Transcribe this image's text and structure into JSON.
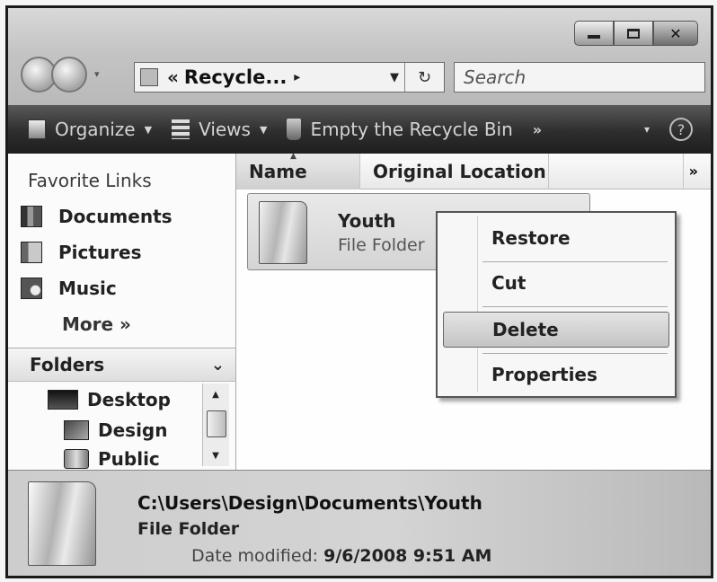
{
  "window": {
    "address": {
      "prefix": "«",
      "location": "Recycle...",
      "arrow": "▸"
    },
    "search_placeholder": "Search",
    "controls": {
      "minimize_icon": "minimize-icon",
      "maximize_icon": "maximize-icon",
      "close_glyph": "✕"
    }
  },
  "toolbar": {
    "organize": "Organize",
    "views": "Views",
    "empty_recycle_bin": "Empty the Recycle Bin",
    "more": "»",
    "help": "?"
  },
  "navpane": {
    "favorites_heading": "Favorite Links",
    "favorites": [
      {
        "label": "Documents",
        "icon": "documents-folder-icon"
      },
      {
        "label": "Pictures",
        "icon": "pictures-folder-icon"
      },
      {
        "label": "Music",
        "icon": "music-folder-icon"
      }
    ],
    "more": "More »",
    "folders_heading": "Folders",
    "tree": [
      {
        "label": "Desktop",
        "icon": "desktop-icon"
      },
      {
        "label": "Design",
        "icon": "user-folder-icon"
      },
      {
        "label": "Public",
        "icon": "public-folder-icon"
      }
    ]
  },
  "content": {
    "columns": [
      "Name",
      "Original Location"
    ],
    "columns_more": "»",
    "items": [
      {
        "name": "Youth",
        "type": "File Folder",
        "icon": "folder-icon"
      }
    ]
  },
  "context_menu": {
    "items": [
      "Restore",
      "Cut",
      "Delete",
      "Properties"
    ],
    "highlighted": "Delete"
  },
  "details": {
    "path": "C:\\Users\\Design\\Documents\\Youth",
    "type": "File Folder",
    "date_label": "Date modified:",
    "date_value": "9/6/2008 9:51 AM"
  }
}
